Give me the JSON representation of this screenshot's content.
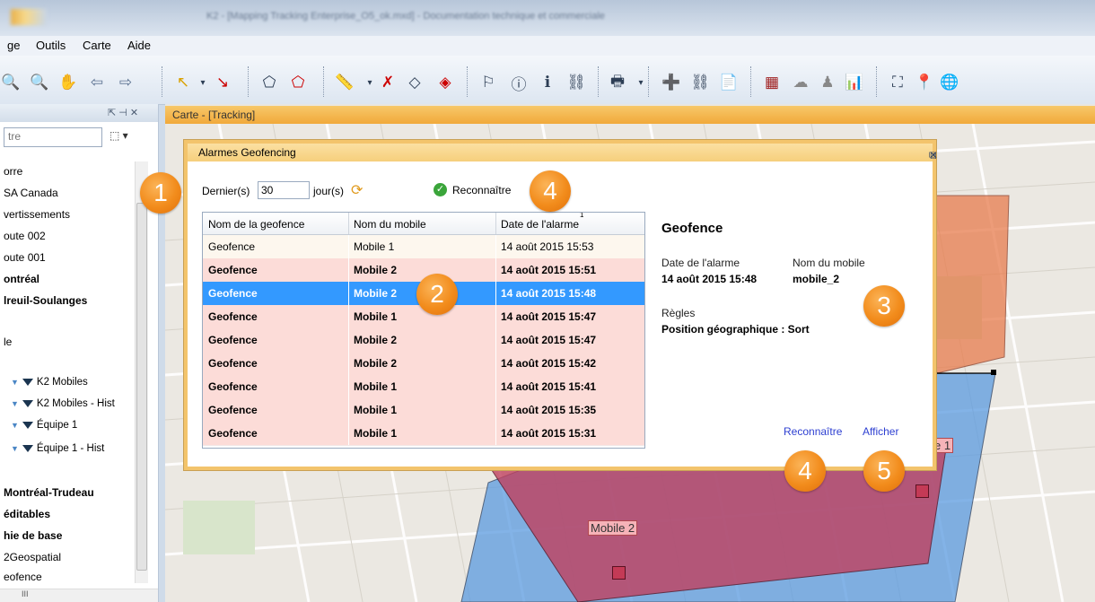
{
  "window": {
    "title": "K2 - [Mapping Tracking Enterprise_O5_ok.mxd] - Documentation technique et commerciale"
  },
  "menu": [
    "ge",
    "Outils",
    "Carte",
    "Aide"
  ],
  "left_panel": {
    "header_controls": "⇱ ⊣ ✕",
    "filter_placeholder": "tre",
    "filter_button": "⬚ ▾",
    "items": [
      {
        "label": "orre",
        "bold": false
      },
      {
        "label": "SA Canada",
        "bold": false
      },
      {
        "label": "vertissements",
        "bold": false
      },
      {
        "label": "oute 002",
        "bold": false
      },
      {
        "label": "oute 001",
        "bold": false
      },
      {
        "label": "ontréal",
        "bold": true
      },
      {
        "label": "lreuil-Soulanges",
        "bold": true
      },
      {
        "label": "le",
        "bold": false
      }
    ],
    "layers": [
      "K2 Mobiles",
      "K2 Mobiles - Hist",
      "Équipe 1",
      "Équipe 1 - Hist"
    ],
    "items_bottom": [
      {
        "label": "Montréal-Trudeau",
        "bold": true
      },
      {
        "label": "éditables",
        "bold": true
      },
      {
        "label": "hie de base",
        "bold": true
      },
      {
        "label": "2Geospatial",
        "bold": false
      },
      {
        "label": "eofence",
        "bold": false
      }
    ],
    "hscroll_label": "III"
  },
  "map": {
    "tab_title": "Carte - [Tracking]",
    "label_mobile2": "Mobile 2",
    "label_partial": "e 1",
    "colors": {
      "red_zone": "#c0415f",
      "blue_zone": "#5b9be0",
      "orange_zone": "#e87d4e"
    }
  },
  "dialog": {
    "title": "Alarmes Geofencing",
    "days_label": "Dernier(s)",
    "days_value": "30",
    "days_unit": "jour(s)",
    "ack_button": "Reconnaître",
    "sort_indicator": "1",
    "columns": [
      "Nom de la geofence",
      "Nom du mobile",
      "Date de l'alarme"
    ],
    "rows": [
      {
        "geofence": "Geofence",
        "mobile": "Mobile 1",
        "date": "14 août 2015  15:53",
        "state": "plain"
      },
      {
        "geofence": "Geofence",
        "mobile": "Mobile 2",
        "date": "14 août 2015  15:51",
        "state": "alarm"
      },
      {
        "geofence": "Geofence",
        "mobile": "Mobile 2",
        "date": "14 août 2015  15:48",
        "state": "selected"
      },
      {
        "geofence": "Geofence",
        "mobile": "Mobile 1",
        "date": "14 août 2015  15:47",
        "state": "alarm"
      },
      {
        "geofence": "Geofence",
        "mobile": "Mobile 2",
        "date": "14 août 2015  15:47",
        "state": "alarm"
      },
      {
        "geofence": "Geofence",
        "mobile": "Mobile 2",
        "date": "14 août 2015  15:42",
        "state": "alarm"
      },
      {
        "geofence": "Geofence",
        "mobile": "Mobile 1",
        "date": "14 août 2015  15:41",
        "state": "alarm"
      },
      {
        "geofence": "Geofence",
        "mobile": "Mobile 1",
        "date": "14 août 2015  15:35",
        "state": "alarm"
      },
      {
        "geofence": "Geofence",
        "mobile": "Mobile 1",
        "date": "14 août 2015  15:31",
        "state": "alarm"
      }
    ],
    "details": {
      "title": "Geofence",
      "alarm_date_label": "Date de l'alarme",
      "alarm_date_value": "14 août 2015  15:48",
      "mobile_label": "Nom du mobile",
      "mobile_value": "mobile_2",
      "rules_label": "Règles",
      "rules_value": "Position géographique : Sort",
      "ack_link": "Reconnaître",
      "show_link": "Afficher"
    }
  },
  "callouts": [
    "1",
    "2",
    "3",
    "4",
    "4",
    "5"
  ]
}
